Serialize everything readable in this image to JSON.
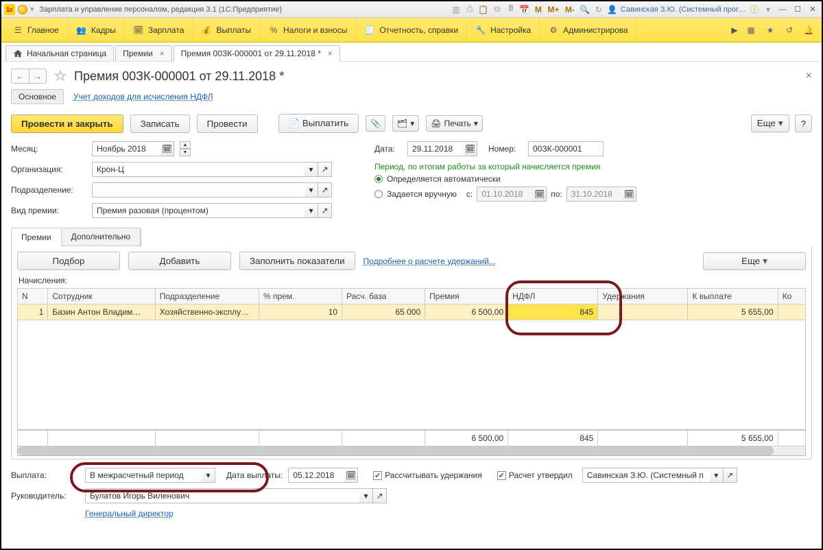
{
  "titlebar": {
    "app_title": "Зарплата и управление персоналом, редакция 3.1  (1С:Предприятие)",
    "user": "Савинская З.Ю. (Системный прог…",
    "text_buttons": [
      "M",
      "M+",
      "M-"
    ]
  },
  "menubar": {
    "items": [
      {
        "label": "Главное"
      },
      {
        "label": "Кадры"
      },
      {
        "label": "Зарплата"
      },
      {
        "label": "Выплаты"
      },
      {
        "label": "Налоги и взносы"
      },
      {
        "label": "Отчетность, справки"
      },
      {
        "label": "Настройка"
      },
      {
        "label": "Администрирова"
      }
    ]
  },
  "tabs": {
    "home": "Начальная страница",
    "list": [
      {
        "label": "Премии"
      },
      {
        "label": "Премия 00ЗК-000001 от 29.11.2018 *"
      }
    ]
  },
  "doc": {
    "title": "Премия 00ЗК-000001 от 29.11.2018 *",
    "sub_main": "Основное",
    "sub_link": "Учет доходов для исчисления НДФЛ",
    "toolbar": {
      "post_close": "Провести и закрыть",
      "write": "Записать",
      "post": "Провести",
      "pay": "Выплатить",
      "print": "Печать",
      "more": "Еще",
      "help": "?"
    },
    "fields": {
      "month_label": "Месяц:",
      "month_value": "Ноябрь 2018",
      "org_label": "Организация:",
      "org_value": "Крон-Ц",
      "dept_label": "Подразделение:",
      "dept_value": "",
      "bonus_type_label": "Вид премии:",
      "bonus_type_value": "Премия разовая (процентом)",
      "date_label": "Дата:",
      "date_value": "29.11.2018",
      "num_label": "Номер:",
      "num_value": "00ЗК-000001",
      "period_title": "Период, по итогам работы за который начисляется премия",
      "radio_auto": "Определяется автоматически",
      "radio_manual": "Задается вручную",
      "from_label": "с:",
      "from_value": "01.10.2018",
      "to_label": "по:",
      "to_value": "31.10.2018"
    },
    "innertabs": {
      "t1": "Премии",
      "t2": "Дополнительно"
    },
    "gridtoolbar": {
      "pick": "Подбор",
      "add": "Добавить",
      "fill": "Заполнить показатели",
      "details": "Подробнее о расчете удержаний...",
      "more": "Еще"
    },
    "accrual_label": "Начисления:",
    "grid": {
      "cols": [
        "N",
        "Сотрудник",
        "Подразделение",
        "% прем.",
        "Расч. база",
        "Премия",
        "НДФЛ",
        "Удержания",
        "К выплате",
        "Ко"
      ],
      "row": {
        "n": "1",
        "emp": "Базин Антон Владим…",
        "dept": "Хозяйственно-эксплу…",
        "pct": "10",
        "base": "65 000",
        "bonus": "6 500,00",
        "ndfl": "845",
        "ded": "",
        "pay": "5 655,00",
        "extra": ""
      },
      "totals": {
        "bonus": "6 500,00",
        "ndfl": "845",
        "ded": "",
        "pay": "5 655,00"
      }
    },
    "bottom": {
      "payout_label": "Выплата:",
      "payout_value": "В межрасчетный период",
      "paydate_label": "Дата выплаты:",
      "paydate_value": "05.12.2018",
      "calc_ded": "Рассчитывать удержания",
      "approved": "Расчет утвердил",
      "approver": "Савинская З.Ю. (Системный п",
      "head_label": "Руководитель:",
      "head_value": "Булатов Игорь Виленович",
      "head_pos": "Генеральный директор"
    }
  }
}
